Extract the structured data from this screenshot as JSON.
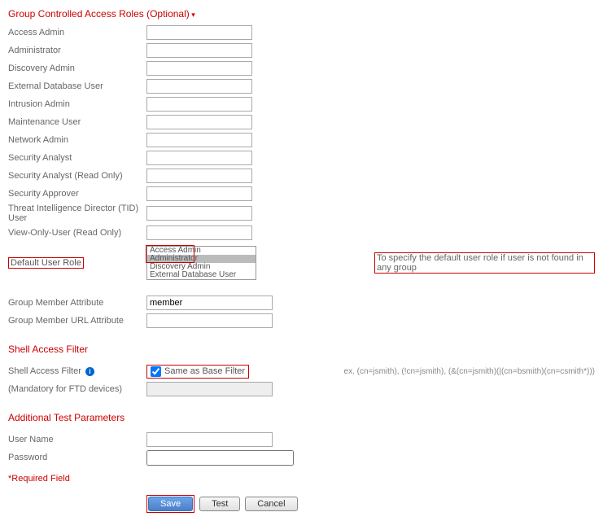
{
  "sections": {
    "group_roles": "Group Controlled Access Roles (Optional)",
    "shell_filter": "Shell Access Filter",
    "test_params": "Additional Test Parameters"
  },
  "roles": {
    "access_admin": "Access Admin",
    "administrator": "Administrator",
    "discovery_admin": "Discovery Admin",
    "external_db_user": "External Database User",
    "intrusion_admin": "Intrusion Admin",
    "maintenance_user": "Maintenance User",
    "network_admin": "Network Admin",
    "security_analyst": "Security Analyst",
    "security_analyst_ro": "Security Analyst (Read Only)",
    "security_approver": "Security Approver",
    "tid_user": "Threat Intelligence Director (TID) User",
    "view_only_ro": "View-Only-User (Read Only)"
  },
  "default_role": {
    "label": "Default User Role",
    "options": {
      "access_admin": "Access Admin",
      "administrator": "Administrator",
      "discovery_admin": "Discovery Admin",
      "external_db_user": "External Database User"
    },
    "selected": "Administrator",
    "note": "To specify the default user role if user is not found in any group"
  },
  "group_attr": {
    "member_label": "Group Member Attribute",
    "member_value": "member",
    "url_label": "Group Member URL Attribute",
    "url_value": ""
  },
  "shell": {
    "filter_label": "Shell Access Filter",
    "mandatory_label": "(Mandatory for FTD devices)",
    "checkbox_label": "Same as Base Filter",
    "checkbox_checked": true,
    "example": "ex. (cn=jsmith), (!cn=jsmith), (&(cn=jsmith)(|(cn=bsmith)(cn=csmith*)))"
  },
  "test": {
    "username_label": "User Name",
    "username_value": "",
    "password_label": "Password",
    "password_value": ""
  },
  "required_text": "*Required Field",
  "buttons": {
    "save": "Save",
    "test": "Test",
    "cancel": "Cancel"
  }
}
